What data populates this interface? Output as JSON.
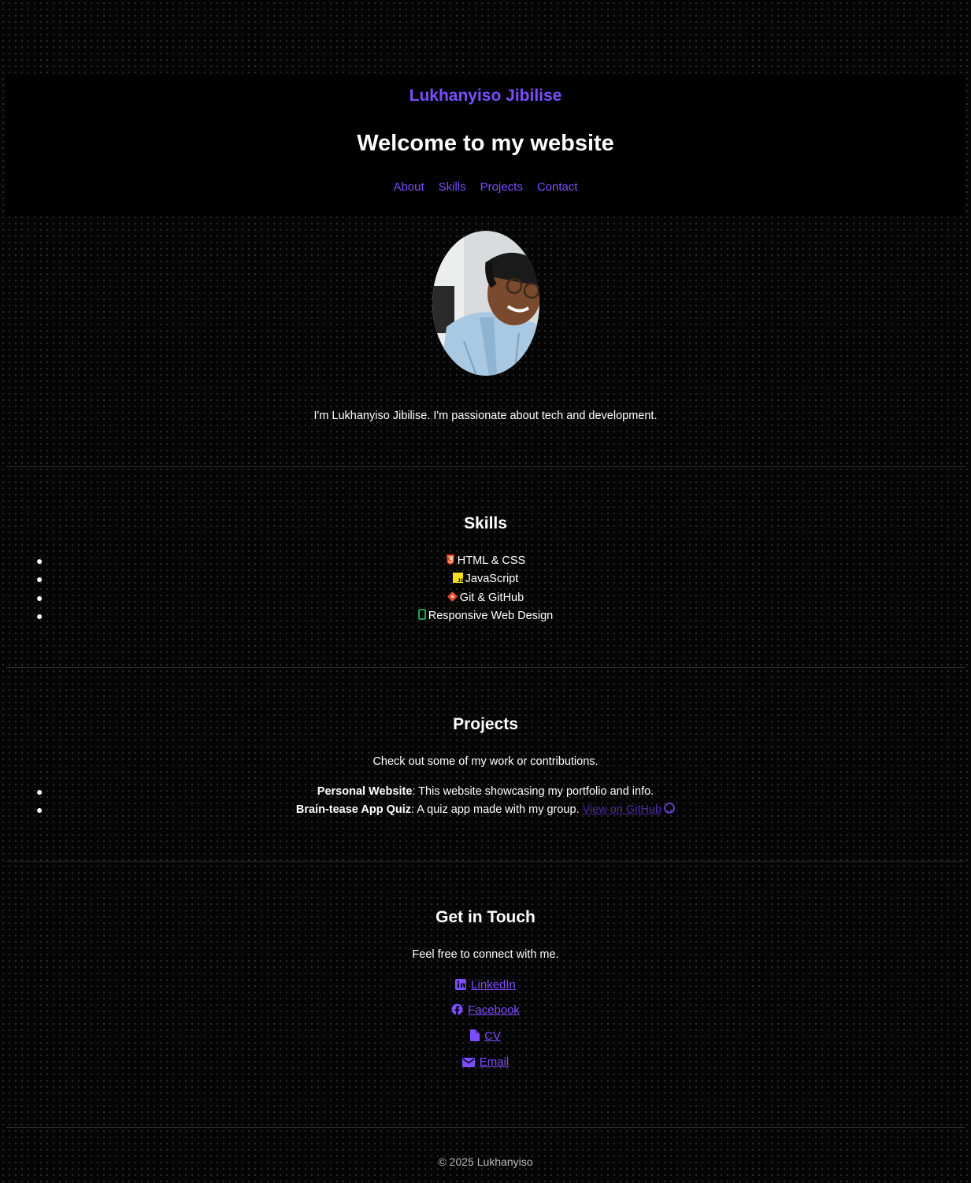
{
  "header": {
    "name": "Lukhanyiso Jibilise",
    "welcome": "Welcome to my website",
    "nav": [
      "About",
      "Skills",
      "Projects",
      "Contact"
    ]
  },
  "about": {
    "intro": "I'm Lukhanyiso Jibilise. I'm passionate about tech and development."
  },
  "skills": {
    "title": "Skills",
    "items": [
      {
        "icon": "html5-icon",
        "label": "HTML & CSS"
      },
      {
        "icon": "javascript-icon",
        "label": "JavaScript"
      },
      {
        "icon": "git-icon",
        "label": "Git & GitHub"
      },
      {
        "icon": "mobile-icon",
        "label": "Responsive Web Design"
      }
    ]
  },
  "projects": {
    "title": "Projects",
    "subtitle": "Check out some of my work or contributions.",
    "items": [
      {
        "name": "Personal Website",
        "description": ": This website showcasing my portfolio and info."
      },
      {
        "name": "Brain-tease App Quiz",
        "description": ": A quiz app made with my group.",
        "link": "View on GitHub"
      }
    ]
  },
  "contact": {
    "title": "Get in Touch",
    "subtitle": "Feel free to connect with me.",
    "links": [
      {
        "icon": "linkedin-icon",
        "label": "LinkedIn"
      },
      {
        "icon": "facebook-icon",
        "label": "Facebook"
      },
      {
        "icon": "file-icon",
        "label": "CV"
      },
      {
        "icon": "envelope-icon",
        "label": "Email"
      }
    ]
  },
  "footer": {
    "text": "© 2025 Lukhanyiso"
  },
  "colors": {
    "accent": "#7c4dff",
    "background": "#050505"
  }
}
